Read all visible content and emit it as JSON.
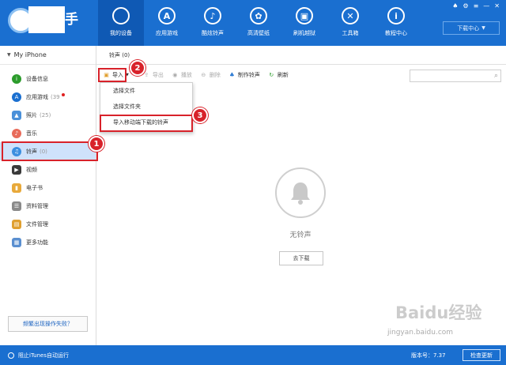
{
  "app": {
    "logo_text": "手"
  },
  "nav": [
    {
      "label": "我的设备",
      "icon": "apple-icon"
    },
    {
      "label": "应用游戏",
      "icon": "appstore-icon"
    },
    {
      "label": "酷炫铃声",
      "icon": "bell-icon"
    },
    {
      "label": "高清壁纸",
      "icon": "flower-icon"
    },
    {
      "label": "刷机越狱",
      "icon": "box-icon"
    },
    {
      "label": "工具箱",
      "icon": "tools-icon"
    },
    {
      "label": "教程中心",
      "icon": "info-icon"
    }
  ],
  "download_center": "下载中心",
  "device_name": "My iPhone",
  "sidebar": [
    {
      "label": "设备信息",
      "count": "",
      "color": "#2c9c2c"
    },
    {
      "label": "应用游戏",
      "count": "(39",
      "color": "#1a6fd0",
      "dot": true
    },
    {
      "label": "照片",
      "count": "(25)",
      "color": "#4a90d9"
    },
    {
      "label": "音乐",
      "count": "",
      "color": "#e86b5a"
    },
    {
      "label": "铃声",
      "count": "(0)",
      "color": "#3b8fe0"
    },
    {
      "label": "视频",
      "count": "",
      "color": "#3a3a3a"
    },
    {
      "label": "电子书",
      "count": "",
      "color": "#e8a93a"
    },
    {
      "label": "资料管理",
      "count": "",
      "color": "#8a8a8a"
    },
    {
      "label": "文件管理",
      "count": "",
      "color": "#e0a030"
    },
    {
      "label": "更多功能",
      "count": "",
      "color": "#5a8fd0"
    }
  ],
  "help_link": "频繁出现操作失败？",
  "main": {
    "tab": "铃声 (0)",
    "toolbar": {
      "import": "导入",
      "export": "导出",
      "play": "播放",
      "delete": "删除",
      "make": "制作铃声",
      "refresh": "刷新"
    },
    "dropdown": [
      "选择文件",
      "选择文件夹",
      "导入移动端下载的铃声"
    ],
    "empty_text": "无铃声",
    "goto_download": "去下载"
  },
  "callouts": [
    "1",
    "2",
    "3"
  ],
  "footer": {
    "itunes": "阻止iTunes自动运行",
    "version": "版本号：7.37",
    "check_update": "检查更新"
  },
  "watermark": {
    "brand": "Baidu经验",
    "url": "jingyan.baidu.com"
  }
}
